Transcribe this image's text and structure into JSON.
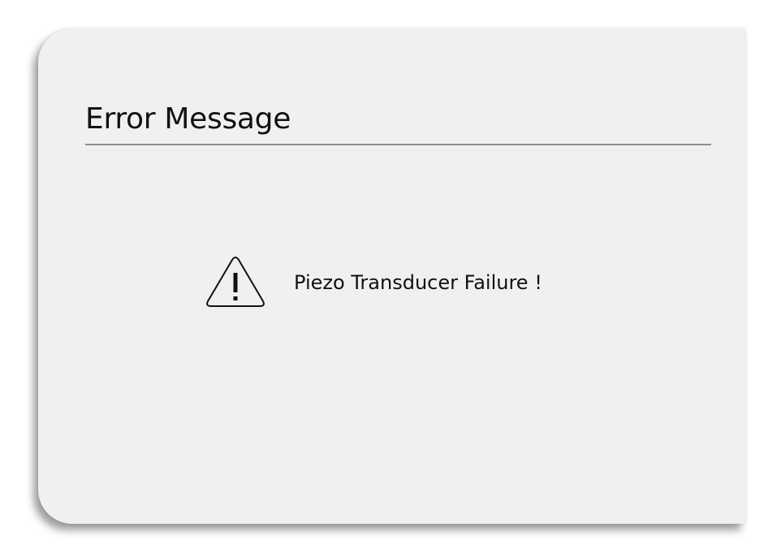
{
  "dialog": {
    "title": "Error Message",
    "message": "Piezo Transducer Failure !",
    "icon": "warning-triangle-icon"
  }
}
